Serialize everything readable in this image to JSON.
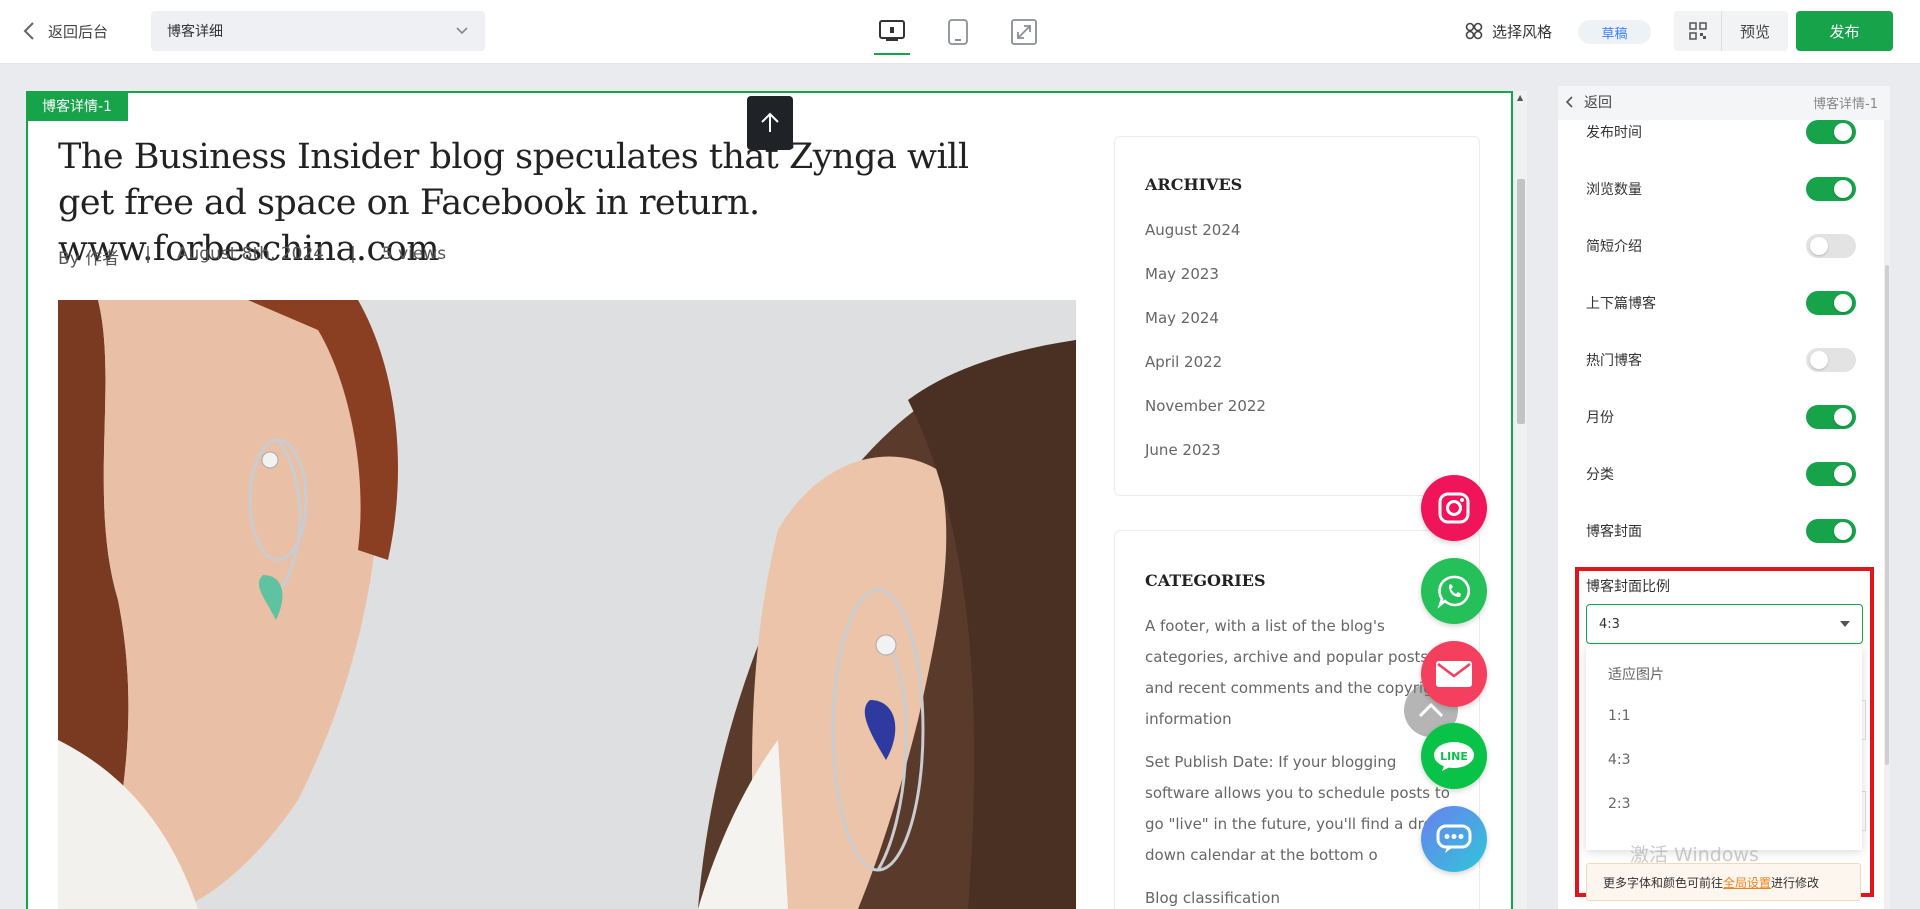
{
  "topbar": {
    "back_label": "返回后台",
    "page_select_value": "博客详细",
    "style_label": "选择风格",
    "draft_badge": "草稿",
    "preview_label": "预览",
    "publish_label": "发布"
  },
  "canvas": {
    "section_tag": "博客详情-1",
    "blog": {
      "title": "The Business Insider blog speculates that Zynga will get free ad space on Facebook in return. www.forbeschina.com",
      "author": "By 作者",
      "sep1": "|",
      "date": "August 8th, 2024",
      "sep2": "|",
      "views": "5 views"
    },
    "archives": {
      "heading": "ARCHIVES",
      "items": [
        "August 2024",
        "May 2023",
        "May 2024",
        "April 2022",
        "November 2022",
        "June 2023"
      ]
    },
    "categories": {
      "heading": "CATEGORIES",
      "para1": "A footer, with a list of the blog's categories, archive and popular posts and recent comments and the copyright information",
      "para2": "Set Publish Date: If your blogging software allows you to schedule posts to go \"live\" in the future, you'll find a drop-down calendar at the bottom o",
      "para3": "Blog classification"
    },
    "float_buttons": {
      "line_label": "LINE"
    }
  },
  "panel": {
    "back_label": "返回",
    "subtitle": "博客详情-1",
    "settings": [
      {
        "label": "发布时间",
        "on": true
      },
      {
        "label": "浏览数量",
        "on": true
      },
      {
        "label": "简短介绍",
        "on": false
      },
      {
        "label": "上下篇博客",
        "on": true
      },
      {
        "label": "热门博客",
        "on": false
      },
      {
        "label": "月份",
        "on": true
      },
      {
        "label": "分类",
        "on": true
      },
      {
        "label": "博客封面",
        "on": true
      }
    ],
    "ratio": {
      "label": "博客封面比例",
      "value": "4:3",
      "options": [
        "适应图片",
        "1:1",
        "4:3",
        "2:3"
      ]
    },
    "notice": {
      "prefix": "更多字体和颜色可前往",
      "link": "全局设置",
      "suffix": "进行修改"
    },
    "watermark": "激活 Windows"
  },
  "colors": {
    "accent": "#16a34a",
    "highlight": "#e0161e",
    "instagram": "#f0145a",
    "whatsapp": "#25c05a",
    "email": "#f43f5e",
    "line": "#09c348",
    "chat": "#4a90e2"
  }
}
